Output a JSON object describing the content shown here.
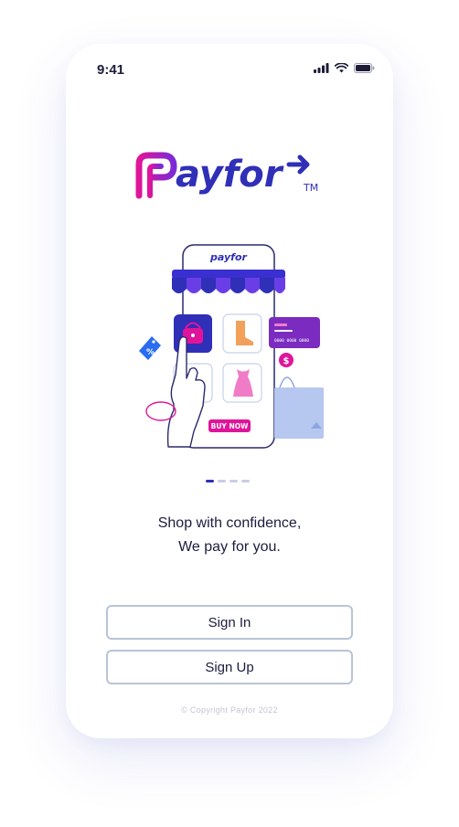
{
  "status_bar": {
    "time": "9:41",
    "icons": [
      "signal-icon",
      "wifi-icon",
      "battery-icon"
    ]
  },
  "brand": {
    "name": "payfor",
    "trademark": "TM",
    "colors": {
      "primary": "#2f2fb8",
      "accent": "#e0149a",
      "gradient_end": "#7a2bd6"
    }
  },
  "illustration": {
    "phone_brand": "payfor",
    "buy_button": "BUY NOW",
    "discount_tag": "%",
    "currency_symbol": "$",
    "card_number": "0000 0000 0000"
  },
  "onboarding": {
    "pages": 4,
    "current_page": 1
  },
  "tagline": {
    "line1": "Shop with confidence,",
    "line2": "We pay for you."
  },
  "actions": {
    "sign_in": "Sign In",
    "sign_up": "Sign Up"
  },
  "footer": {
    "copyright": "© Copyright Payfor 2022"
  }
}
